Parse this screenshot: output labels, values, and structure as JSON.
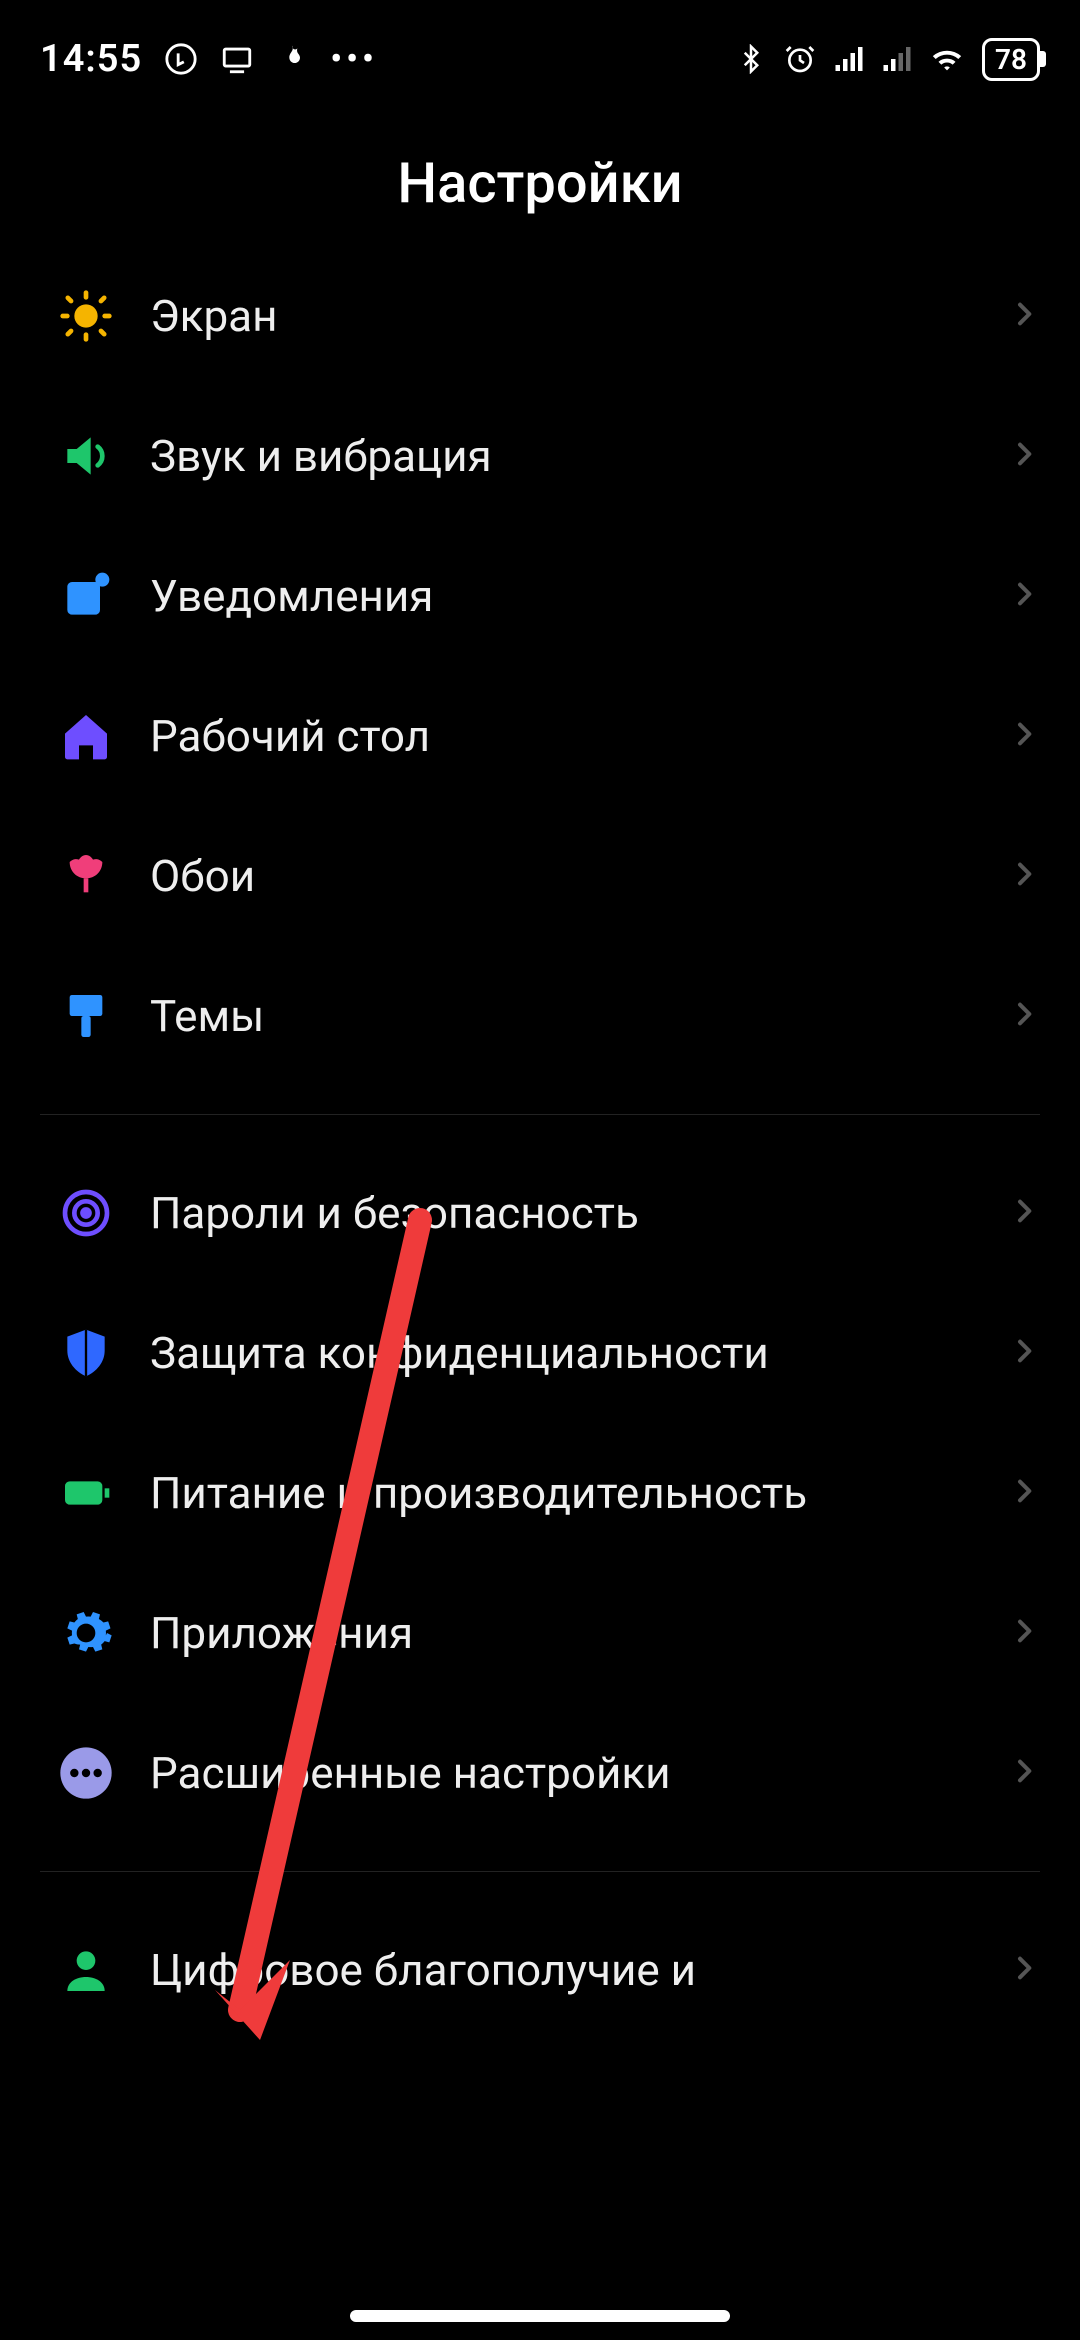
{
  "status": {
    "time": "14:55",
    "battery": "78"
  },
  "title": "Настройки",
  "groups": [
    {
      "items": [
        {
          "id": "display",
          "label": "Экран",
          "icon": "sun",
          "color": "#f5b400"
        },
        {
          "id": "sound",
          "label": "Звук и вибрация",
          "icon": "sound",
          "color": "#1ec66b"
        },
        {
          "id": "notifications",
          "label": "Уведомления",
          "icon": "notify",
          "color": "#2f93ff"
        },
        {
          "id": "home",
          "label": "Рабочий стол",
          "icon": "house",
          "color": "#6e4eff"
        },
        {
          "id": "wallpaper",
          "label": "Обои",
          "icon": "tulip",
          "color": "#f03e7a"
        },
        {
          "id": "themes",
          "label": "Темы",
          "icon": "brush",
          "color": "#2f93ff"
        }
      ]
    },
    {
      "items": [
        {
          "id": "security",
          "label": "Пароли и безопасность",
          "icon": "fingerprint",
          "color": "#6e4eff"
        },
        {
          "id": "privacy",
          "label": "Защита конфиденциальности",
          "icon": "shield",
          "color": "#2f68ff"
        },
        {
          "id": "battery",
          "label": "Питание и производительность",
          "icon": "battery",
          "color": "#1ec66b"
        },
        {
          "id": "apps",
          "label": "Приложения",
          "icon": "gear",
          "color": "#2f93ff"
        },
        {
          "id": "advanced",
          "label": "Расширенные настройки",
          "icon": "dots",
          "color": "#9a9ae8"
        }
      ]
    },
    {
      "items": [
        {
          "id": "wellbeing",
          "label": "Цифровое благополучие и",
          "icon": "person",
          "color": "#1ec66b"
        }
      ]
    }
  ],
  "annotation": {
    "target": "advanced"
  }
}
